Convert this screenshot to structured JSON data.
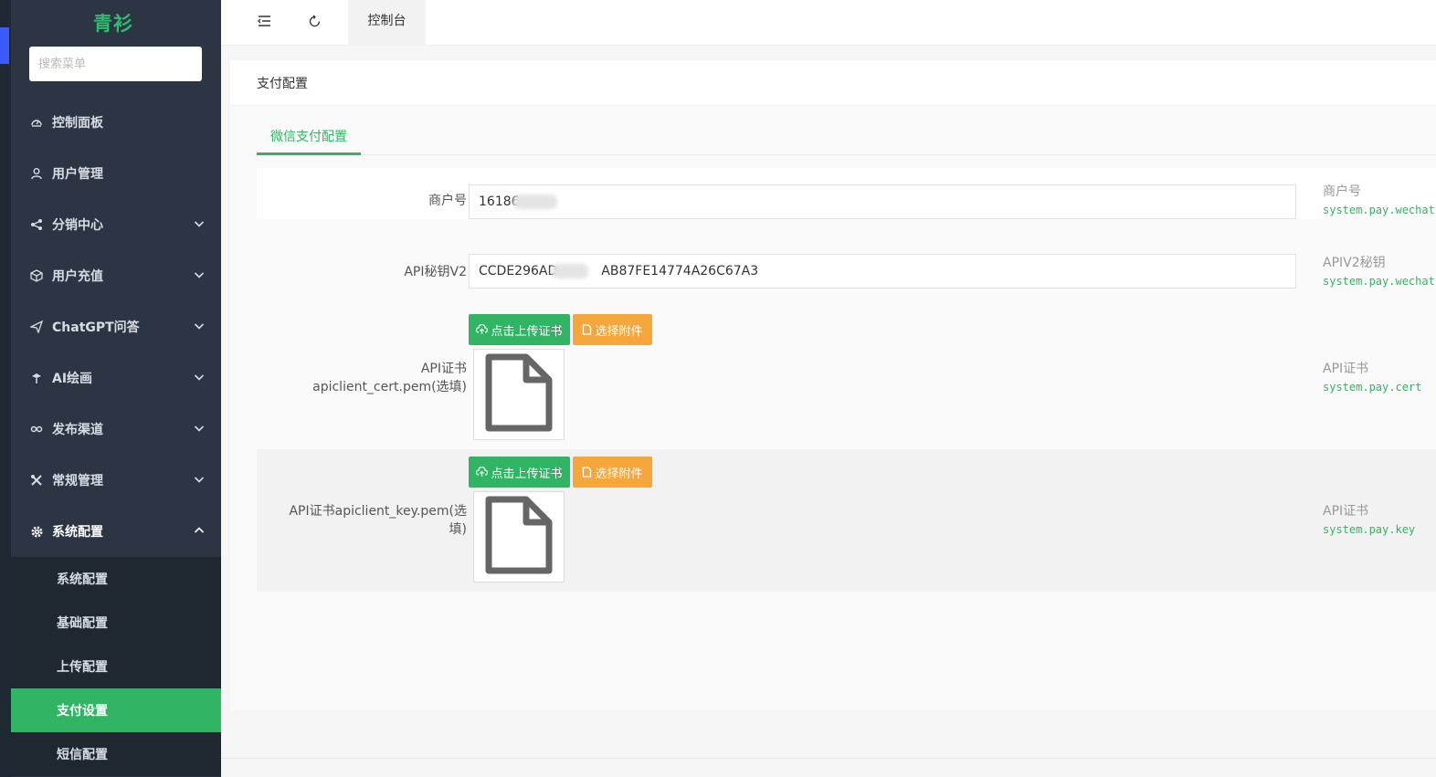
{
  "brand": "青衫",
  "search": {
    "placeholder": "搜索菜单"
  },
  "sidebar": {
    "items": [
      {
        "label": "控制面板",
        "icon": "dashboard-icon"
      },
      {
        "label": "用户管理",
        "icon": "user-icon"
      },
      {
        "label": "分销中心",
        "icon": "share-icon"
      },
      {
        "label": "用户充值",
        "icon": "cube-icon"
      },
      {
        "label": "ChatGPT问答",
        "icon": "send-icon"
      },
      {
        "label": "AI绘画",
        "icon": "brush-icon"
      },
      {
        "label": "发布渠道",
        "icon": "link-icon"
      },
      {
        "label": "常规管理",
        "icon": "tools-icon"
      },
      {
        "label": "系统配置",
        "icon": "gear-icon"
      }
    ],
    "submenu": [
      {
        "label": "系统配置"
      },
      {
        "label": "基础配置"
      },
      {
        "label": "上传配置"
      },
      {
        "label": "支付设置",
        "active": true
      },
      {
        "label": "短信配置"
      }
    ]
  },
  "topbar": {
    "tab": "控制台",
    "icons": [
      "menu-fold-icon",
      "refresh-icon"
    ]
  },
  "card": {
    "title": "支付配置",
    "tab": "微信支付配置",
    "fields": [
      {
        "label": "商户号",
        "value": "16186",
        "help_title": "商户号",
        "help_code": "system.pay.wechat"
      },
      {
        "label": "API秘钥V2",
        "value": "CCDE296AD",
        "value_tail": "AB87FE14774A26C67A3",
        "help_title": "APIV2秘钥",
        "help_code": "system.pay.wechat"
      },
      {
        "label": "API证书apiclient_cert.pem(选填)",
        "help_title": "API证书",
        "help_code": "system.pay.cert"
      },
      {
        "label": "API证书apiclient_key.pem(选填)",
        "help_title": "API证书",
        "help_code": "system.pay.key"
      }
    ],
    "upload_label": "点击上传证书",
    "choose_label": "选择附件"
  },
  "colors": {
    "accent": "#31b565",
    "orange": "#f5a73b",
    "sidebar": "#2b3543",
    "brand": "#2dbd6e"
  }
}
